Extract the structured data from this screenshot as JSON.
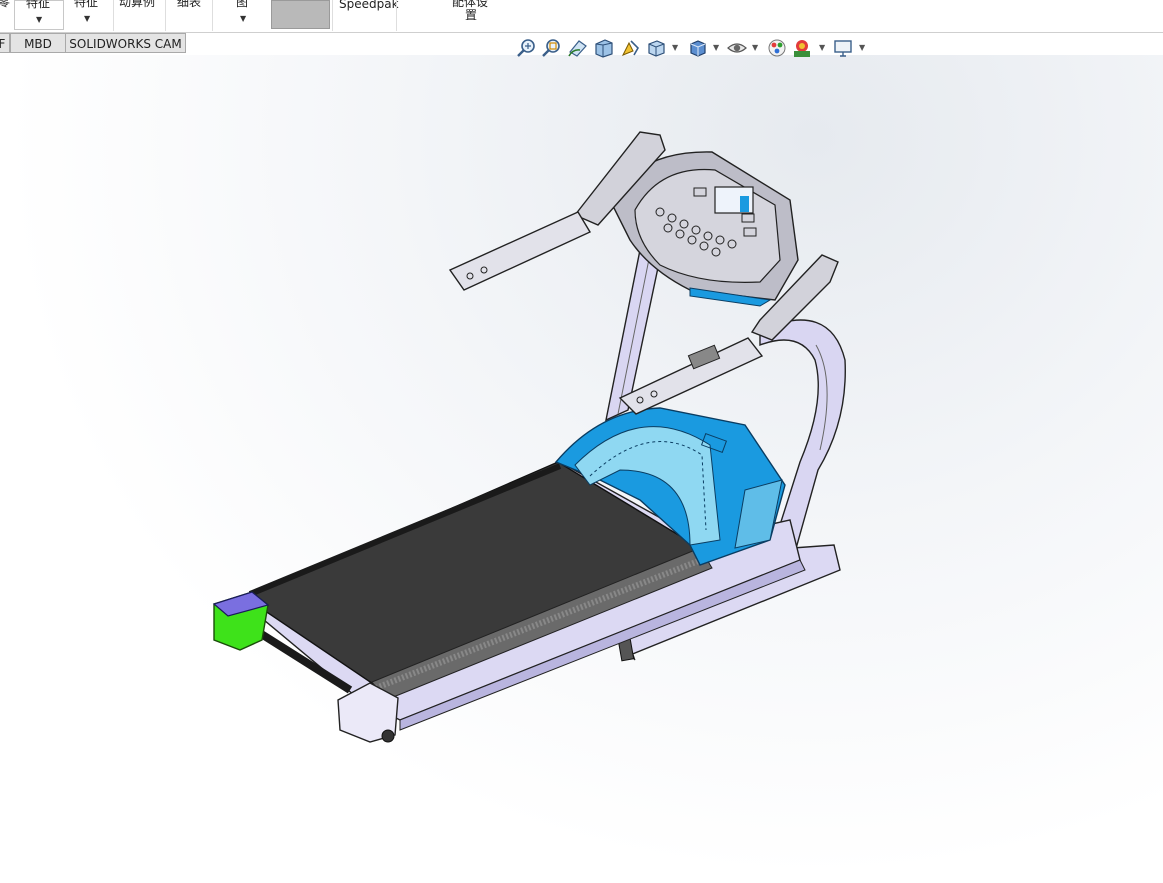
{
  "ribbon": {
    "items": [
      {
        "label": "零"
      },
      {
        "label": "特征"
      },
      {
        "label": "特征"
      },
      {
        "label": "动算例"
      },
      {
        "label": "细表"
      },
      {
        "label": "图"
      },
      {
        "label": "Speedpak"
      },
      {
        "label": "配体设"
      },
      {
        "label": "置"
      }
    ]
  },
  "tabs": [
    {
      "label": "F"
    },
    {
      "label": "MBD"
    },
    {
      "label": "SOLIDWORKS CAM"
    }
  ],
  "heads_up_toolbar": {
    "icons": [
      "zoom-to-fit-icon",
      "zoom-to-area-icon",
      "previous-view-icon",
      "section-view-icon",
      "dynamic-annotation-icon",
      "view-orientation-icon",
      "display-style-icon",
      "hide-show-icon",
      "edit-appearance-icon",
      "apply-scene-icon",
      "view-settings-icon"
    ]
  },
  "colors": {
    "console_blue": "#0a8fd6",
    "motor_cover": "#1a9ae0",
    "frame": "#d9d6f2",
    "belt": "#3a3a3a",
    "end_cap_green": "#3ee21a",
    "end_cap_violet": "#7a6fe0"
  }
}
